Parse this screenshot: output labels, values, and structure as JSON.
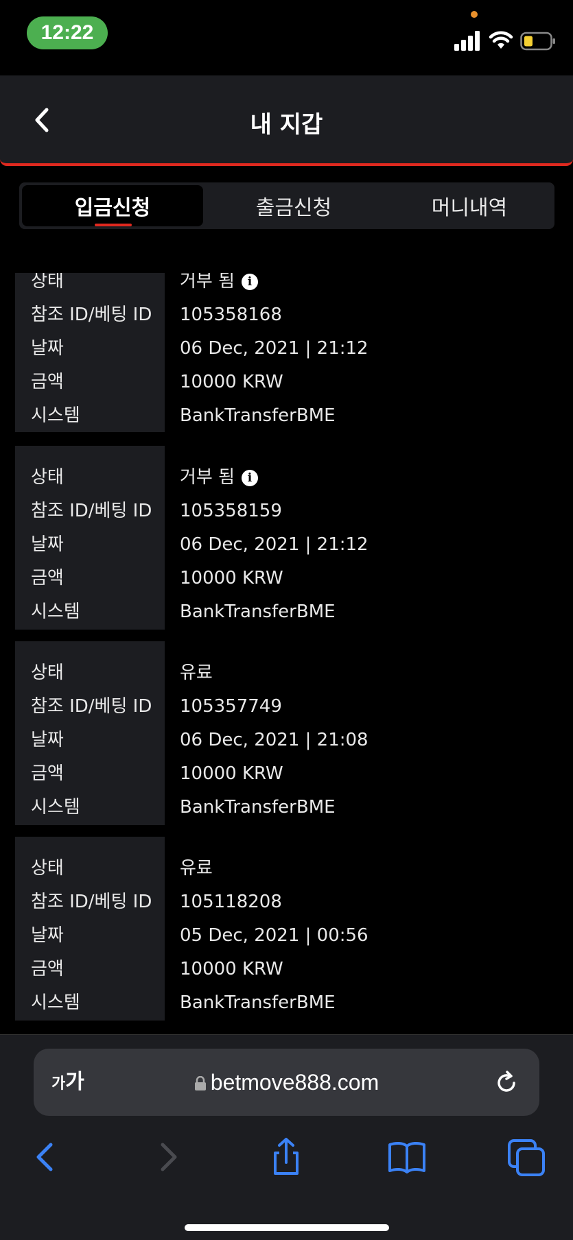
{
  "status_bar": {
    "time": "12:22",
    "icons": [
      "signal-icon",
      "wifi-icon",
      "battery-icon"
    ]
  },
  "header": {
    "title": "내 지갑",
    "back_icon": "chevron-left-icon"
  },
  "tabs": [
    {
      "label": "입금신청",
      "active": true
    },
    {
      "label": "출금신청",
      "active": false
    },
    {
      "label": "머니내역",
      "active": false
    }
  ],
  "labels": {
    "status": "상태",
    "ref_id": "참조 ID/베팅 ID",
    "date": "날짜",
    "amount": "금액",
    "system": "시스템"
  },
  "records": [
    {
      "status": "거부 됨",
      "has_info": true,
      "ref_id": "105358168",
      "date": "06 Dec, 2021 | 21:12",
      "amount": "10000 KRW",
      "system": "BankTransferBME"
    },
    {
      "status": "거부 됨",
      "has_info": true,
      "ref_id": "105358159",
      "date": "06 Dec, 2021 | 21:12",
      "amount": "10000 KRW",
      "system": "BankTransferBME"
    },
    {
      "status": "유료",
      "has_info": false,
      "ref_id": "105357749",
      "date": "06 Dec, 2021 | 21:08",
      "amount": "10000 KRW",
      "system": "BankTransferBME"
    },
    {
      "status": "유료",
      "has_info": false,
      "ref_id": "105118208",
      "date": "05 Dec, 2021 | 00:56",
      "amount": "10000 KRW",
      "system": "BankTransferBME"
    }
  ],
  "browser": {
    "text_size_small": "가",
    "text_size_large": "가",
    "url": "betmove888.com"
  },
  "colors": {
    "accent": "#e0291f",
    "panel": "#1c1d21",
    "ios_blue": "#3b82f6",
    "time_pill": "#4caf50"
  }
}
